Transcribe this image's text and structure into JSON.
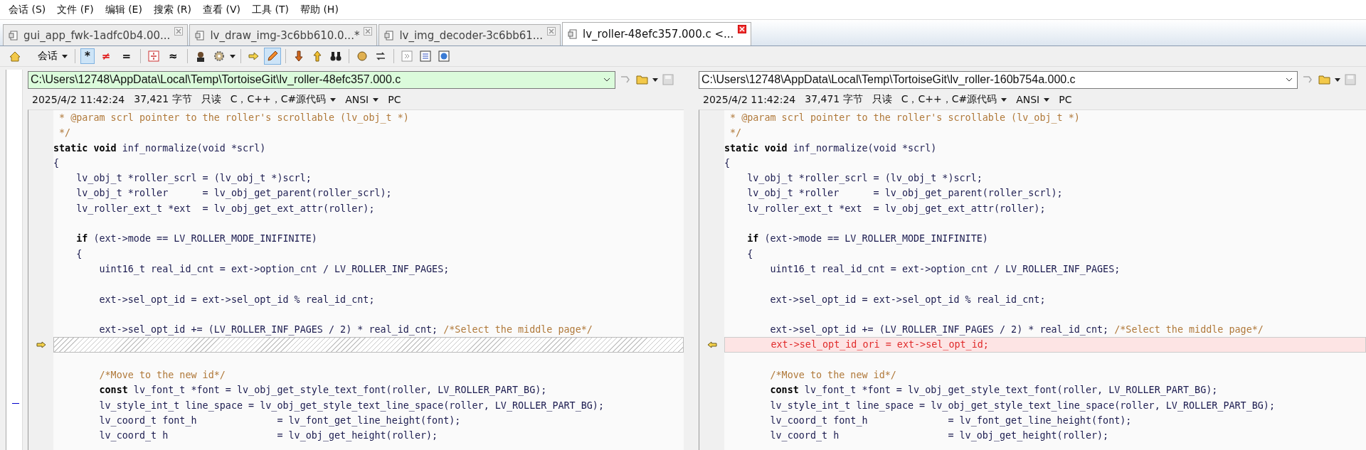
{
  "menu": [
    "会话 (S)",
    "文件 (F)",
    "编辑 (E)",
    "搜索 (R)",
    "查看 (V)",
    "工具 (T)",
    "帮助 (H)"
  ],
  "tabs": [
    {
      "label": "gui_app_fwk-1adfc0b4.00...",
      "selected": false
    },
    {
      "label": "lv_draw_img-3c6bb610.0...*",
      "selected": false
    },
    {
      "label": "lv_img_decoder-3c6bb61...",
      "selected": false
    },
    {
      "label": "lv_roller-48efc357.000.c <...",
      "selected": true
    }
  ],
  "toolbar": {
    "session": "会话",
    "filters": [
      {
        "label": "*",
        "selected": true
      },
      {
        "label": "≠",
        "selected": false
      },
      {
        "label": "=",
        "selected": false
      }
    ],
    "approx": "≈",
    "edit_selected": true
  },
  "panes": [
    {
      "path": "C:\\Users\\12748\\AppData\\Local\\Temp\\TortoiseGit\\lv_roller-48efc357.000.c",
      "active": true,
      "date": "2025/4/2 11:42:24",
      "size": "37,421 字节",
      "readonly": "只读",
      "language": "C，C++，C#源代码",
      "encoding": "ANSI",
      "line_ending": "PC",
      "lines": [
        {
          "kind": "same",
          "comment": " * @param scrl pointer to the roller's scrollable (lv_obj_t *)"
        },
        {
          "kind": "same",
          "comment": " */"
        },
        {
          "kind": "same",
          "code": "**static void** inf_normalize(void *scrl)"
        },
        {
          "kind": "same",
          "code": "{"
        },
        {
          "kind": "same",
          "code": "    lv_obj_t *roller_scrl = (lv_obj_t *)scrl;"
        },
        {
          "kind": "same",
          "code": "    lv_obj_t *roller      = lv_obj_get_parent(roller_scrl);"
        },
        {
          "kind": "same",
          "code": "    lv_roller_ext_t *ext  = lv_obj_get_ext_attr(roller);"
        },
        {
          "kind": "same"
        },
        {
          "kind": "same",
          "code": "    **if** (ext->mode == LV_ROLLER_MODE_INIFINITE)"
        },
        {
          "kind": "same",
          "code": "    {"
        },
        {
          "kind": "same",
          "code": "        uint16_t real_id_cnt = ext->option_cnt / LV_ROLLER_INF_PAGES;"
        },
        {
          "kind": "same"
        },
        {
          "kind": "same",
          "code": "        ext->sel_opt_id = ext->sel_opt_id % real_id_cnt;"
        },
        {
          "kind": "same"
        },
        {
          "kind": "same",
          "code": "        ext->sel_opt_id += (LV_ROLLER_INF_PAGES / 2) * real_id_cnt; ",
          "comment": "/*Select the middle page*/"
        },
        {
          "kind": "missing"
        },
        {
          "kind": "same"
        },
        {
          "kind": "same",
          "comment": "        /*Move to the new id*/"
        },
        {
          "kind": "same",
          "code": "        **const** lv_font_t *font = lv_obj_get_style_text_font(roller, LV_ROLLER_PART_BG);"
        },
        {
          "kind": "same",
          "code": "        lv_style_int_t line_space = lv_obj_get_style_text_line_space(roller, LV_ROLLER_PART_BG);"
        },
        {
          "kind": "same",
          "code": "        lv_coord_t font_h              = lv_font_get_line_height(font);"
        },
        {
          "kind": "same",
          "code": "        lv_coord_t h                   = lv_obj_get_height(roller);"
        }
      ]
    },
    {
      "path": "C:\\Users\\12748\\AppData\\Local\\Temp\\TortoiseGit\\lv_roller-160b754a.000.c",
      "active": false,
      "date": "2025/4/2 11:42:24",
      "size": "37,471 字节",
      "readonly": "只读",
      "language": "C，C++，C#源代码",
      "encoding": "ANSI",
      "line_ending": "PC",
      "lines": [
        {
          "kind": "same",
          "comment": " * @param scrl pointer to the roller's scrollable (lv_obj_t *)"
        },
        {
          "kind": "same",
          "comment": " */"
        },
        {
          "kind": "same",
          "code": "**static void** inf_normalize(void *scrl)"
        },
        {
          "kind": "same",
          "code": "{"
        },
        {
          "kind": "same",
          "code": "    lv_obj_t *roller_scrl = (lv_obj_t *)scrl;"
        },
        {
          "kind": "same",
          "code": "    lv_obj_t *roller      = lv_obj_get_parent(roller_scrl);"
        },
        {
          "kind": "same",
          "code": "    lv_roller_ext_t *ext  = lv_obj_get_ext_attr(roller);"
        },
        {
          "kind": "same"
        },
        {
          "kind": "same",
          "code": "    **if** (ext->mode == LV_ROLLER_MODE_INIFINITE)"
        },
        {
          "kind": "same",
          "code": "    {"
        },
        {
          "kind": "same",
          "code": "        uint16_t real_id_cnt = ext->option_cnt / LV_ROLLER_INF_PAGES;"
        },
        {
          "kind": "same"
        },
        {
          "kind": "same",
          "code": "        ext->sel_opt_id = ext->sel_opt_id % real_id_cnt;"
        },
        {
          "kind": "same"
        },
        {
          "kind": "same",
          "code": "        ext->sel_opt_id += (LV_ROLLER_INF_PAGES / 2) * real_id_cnt; ",
          "comment": "/*Select the middle page*/"
        },
        {
          "kind": "added",
          "code": "        ext->sel_opt_id_ori = ext->sel_opt_id;"
        },
        {
          "kind": "same"
        },
        {
          "kind": "same",
          "comment": "        /*Move to the new id*/"
        },
        {
          "kind": "same",
          "code": "        **const** lv_font_t *font = lv_obj_get_style_text_font(roller, LV_ROLLER_PART_BG);"
        },
        {
          "kind": "same",
          "code": "        lv_style_int_t line_space = lv_obj_get_style_text_line_space(roller, LV_ROLLER_PART_BG);"
        },
        {
          "kind": "same",
          "code": "        lv_coord_t font_h              = lv_font_get_line_height(font);"
        },
        {
          "kind": "same",
          "code": "        lv_coord_t h                   = lv_obj_get_height(roller);"
        }
      ]
    }
  ]
}
